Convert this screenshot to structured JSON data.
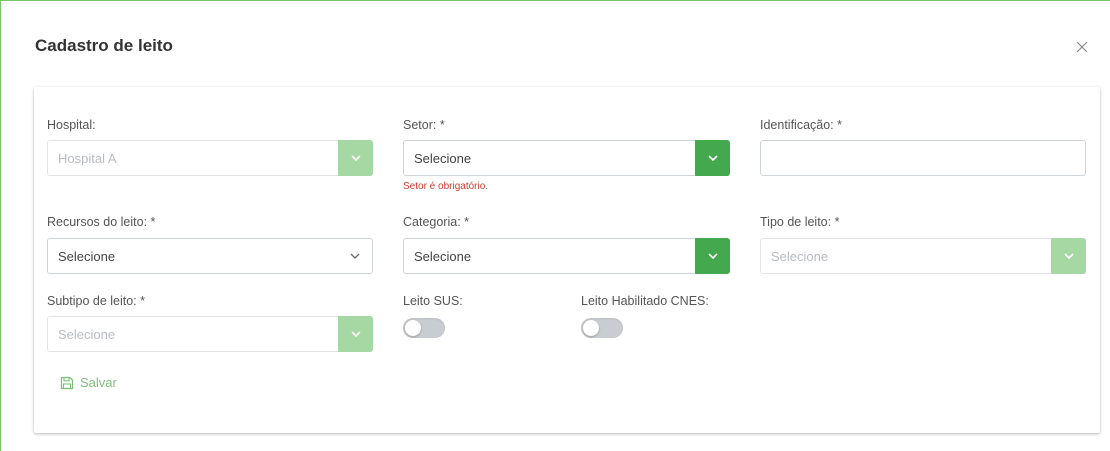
{
  "modal": {
    "title": "Cadastro de leito"
  },
  "fields": {
    "hospital": {
      "label": "Hospital:",
      "value": "Hospital A"
    },
    "setor": {
      "label": "Setor: *",
      "value": "Selecione",
      "error": "Setor é obrigatório."
    },
    "identificacao": {
      "label": "Identificação: *",
      "value": ""
    },
    "recursos": {
      "label": "Recursos do leito: *",
      "value": "Selecione"
    },
    "categoria": {
      "label": "Categoria: *",
      "value": "Selecione"
    },
    "tipo": {
      "label": "Tipo de leito: *",
      "value": "Selecione"
    },
    "subtipo": {
      "label": "Subtipo de leito: *",
      "value": "Selecione"
    },
    "leito_sus": {
      "label": "Leito SUS:",
      "checked": false
    },
    "leito_cnes": {
      "label": "Leito Habilitado CNES:",
      "checked": false
    }
  },
  "actions": {
    "save_label": "Salvar"
  },
  "colors": {
    "accent": "#44a84e",
    "accent_disabled": "#a6d8a4",
    "error": "#d33a2c"
  },
  "icons": {
    "close": "close-icon",
    "chevron": "chevron-down-icon",
    "save": "floppy-disk-icon"
  }
}
